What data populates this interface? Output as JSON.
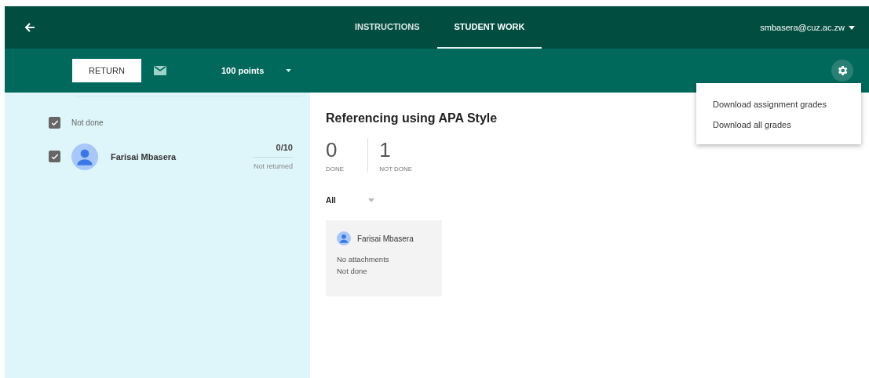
{
  "top_bar": {
    "tabs": [
      {
        "label": "INSTRUCTIONS",
        "selected": false
      },
      {
        "label": "STUDENT WORK",
        "selected": true
      }
    ],
    "account": "smbasera@cuz.ac.zw"
  },
  "toolbar": {
    "return_button": "RETURN",
    "points": "100 points"
  },
  "sidebar": {
    "group": {
      "label": "Not done",
      "checked": true
    },
    "students": [
      {
        "name": "Farisai Mbasera",
        "checked": true,
        "grade": "0/10",
        "status": "Not returned"
      }
    ]
  },
  "assignment": {
    "title": "Referencing using APA Style",
    "stats": [
      {
        "count": "0",
        "label": "DONE"
      },
      {
        "count": "1",
        "label": "NOT DONE"
      }
    ],
    "filter": "All",
    "cards": [
      {
        "name": "Farisai Mbasera",
        "attachments": "No attachments",
        "status": "Not done"
      }
    ]
  },
  "settings_menu": {
    "open": true,
    "items": [
      "Download assignment grades",
      "Download all grades"
    ]
  }
}
